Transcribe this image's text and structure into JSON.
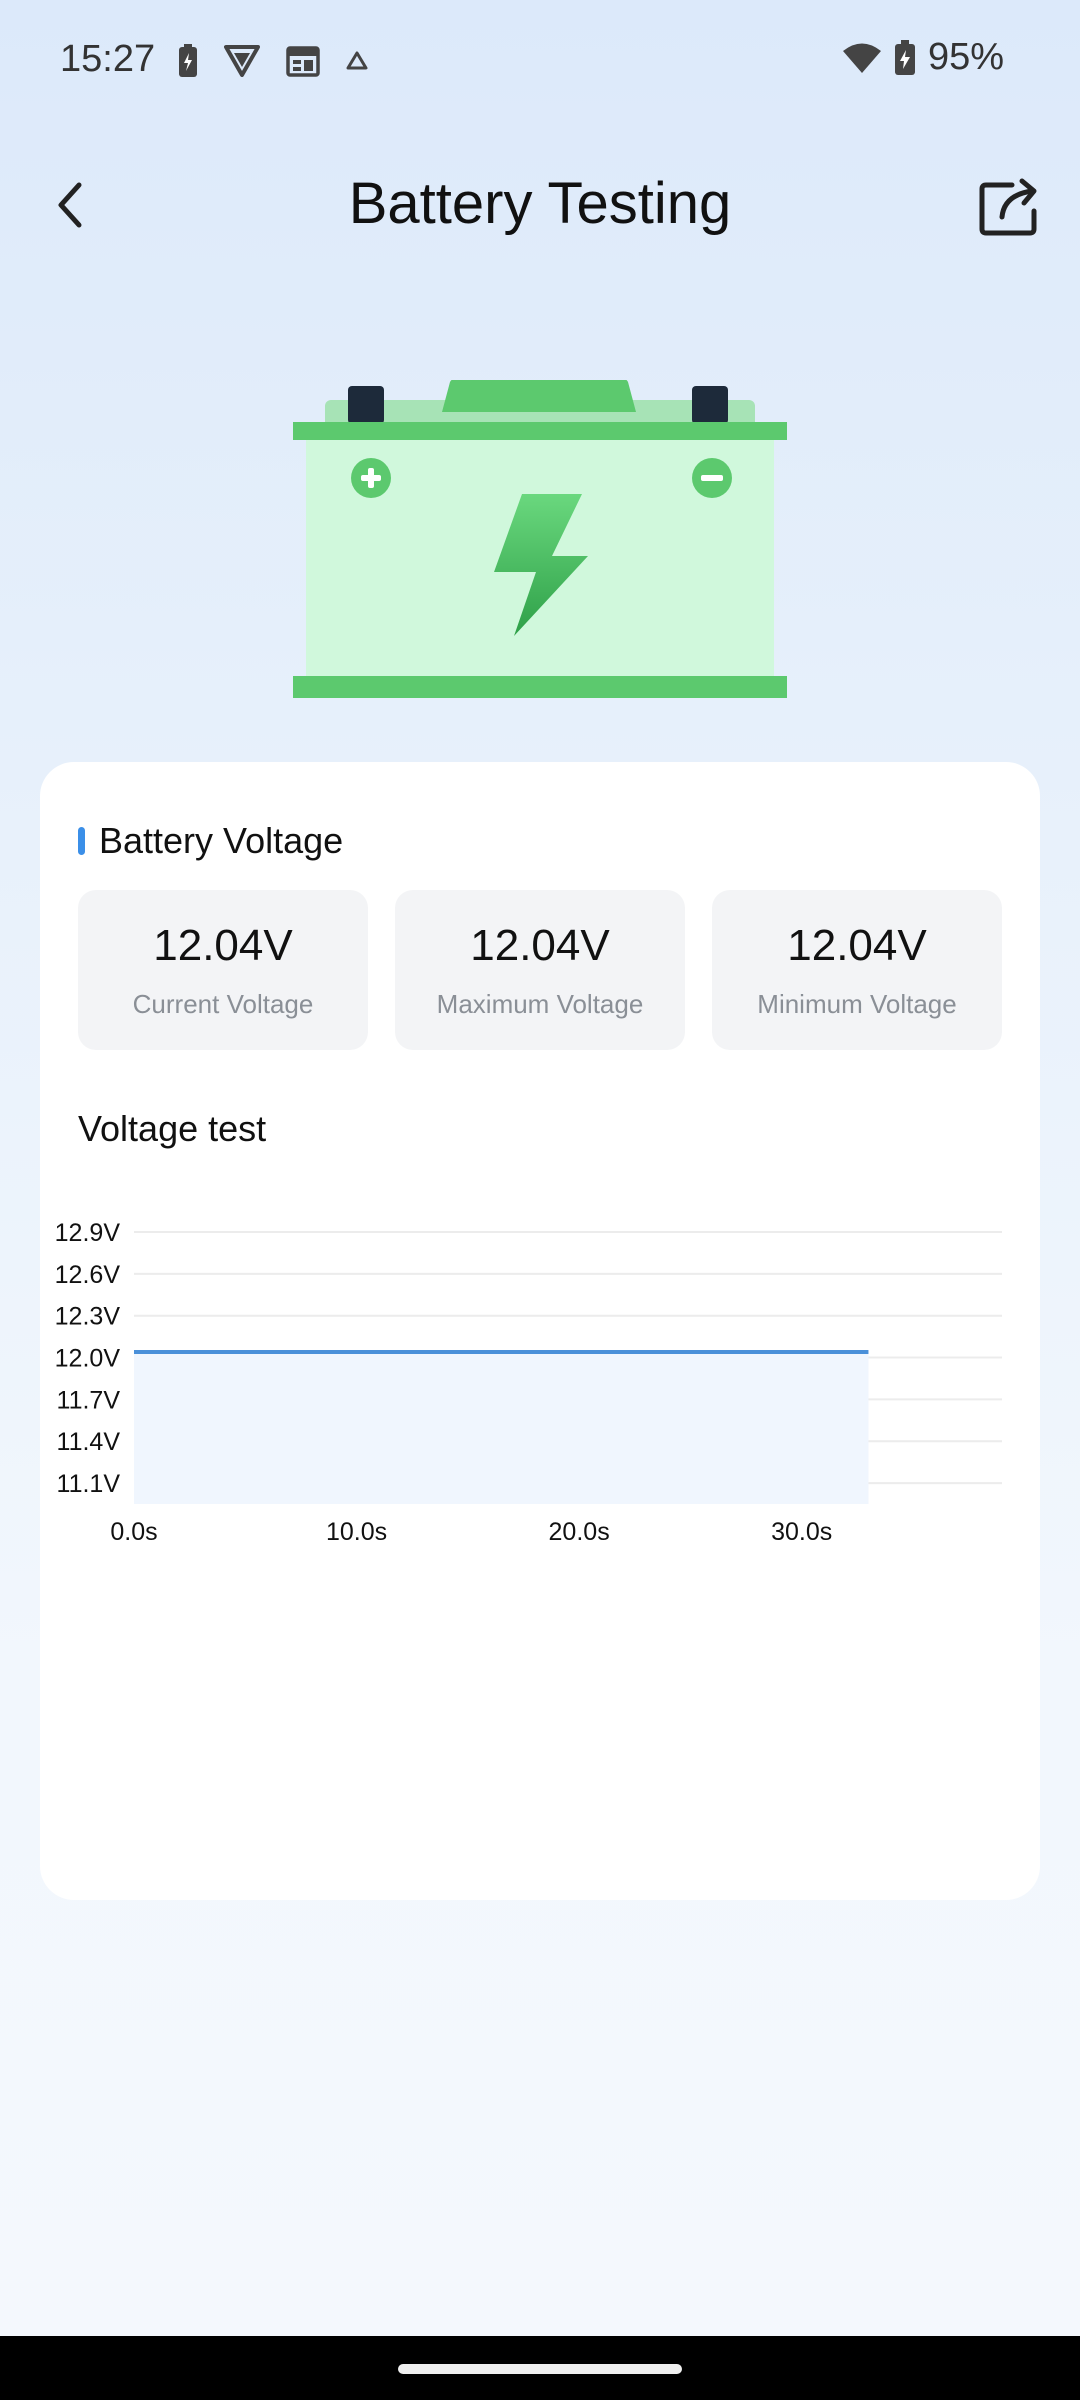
{
  "status_bar": {
    "time": "15:27",
    "battery_percent": "95%",
    "left_icons": [
      "battery-charging-icon",
      "shield-vpn-icon",
      "calendar-icon",
      "drive-icon"
    ],
    "right_icons": [
      "wifi-icon",
      "battery-icon"
    ]
  },
  "header": {
    "title": "Battery Testing",
    "back_icon": "chevron-left-icon",
    "share_icon": "share-icon"
  },
  "voltage_section": {
    "title": "Battery Voltage",
    "stats": [
      {
        "value": "12.04V",
        "label": "Current Voltage"
      },
      {
        "value": "12.04V",
        "label": "Maximum Voltage"
      },
      {
        "value": "12.04V",
        "label": "Minimum Voltage"
      }
    ]
  },
  "chart_section": {
    "title": "Voltage test"
  },
  "chart_data": {
    "type": "area",
    "x": [
      0,
      33
    ],
    "y": [
      12.04,
      12.04
    ],
    "ylim": [
      10.95,
      12.9
    ],
    "xlim": [
      0,
      39
    ],
    "y_ticks": [
      "12.9V",
      "12.6V",
      "12.3V",
      "12.0V",
      "11.7V",
      "11.4V",
      "11.1V"
    ],
    "x_ticks": [
      "0.0s",
      "10.0s",
      "20.0s",
      "30.0s"
    ],
    "line_color": "#4a90d9",
    "fill_color": "#f0f6fe",
    "grid": true
  },
  "colors": {
    "accent": "#3b8fe8",
    "battery_green": "#5cc96e",
    "battery_body": "#d0f8dc"
  }
}
